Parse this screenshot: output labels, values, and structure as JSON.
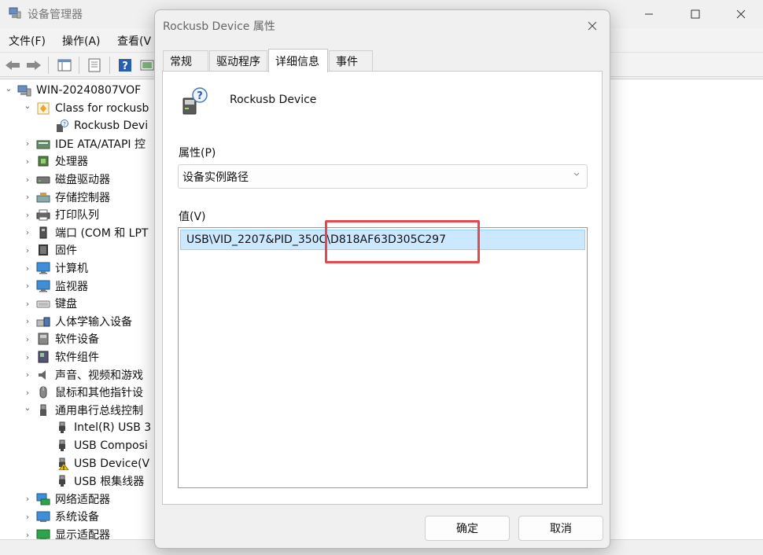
{
  "main_window": {
    "title": "设备管理器",
    "menu": [
      "文件(F)",
      "操作(A)",
      "查看(V"
    ],
    "tree": [
      {
        "label": "WIN-20240807VOF",
        "level": 0,
        "expand": "v",
        "icon": "computer-icon"
      },
      {
        "label": "Class for rockusb",
        "level": 1,
        "expand": "v",
        "icon": "class-icon"
      },
      {
        "label": "Rockusb Devi",
        "level": 2,
        "expand": "",
        "icon": "unknown-device-icon"
      },
      {
        "label": "IDE ATA/ATAPI 控",
        "level": 1,
        "expand": ">",
        "icon": "ide-icon"
      },
      {
        "label": "处理器",
        "level": 1,
        "expand": ">",
        "icon": "cpu-icon"
      },
      {
        "label": "磁盘驱动器",
        "level": 1,
        "expand": ">",
        "icon": "disk-icon"
      },
      {
        "label": "存储控制器",
        "level": 1,
        "expand": ">",
        "icon": "storage-icon"
      },
      {
        "label": "打印队列",
        "level": 1,
        "expand": ">",
        "icon": "printer-icon"
      },
      {
        "label": "端口 (COM 和 LPT",
        "level": 1,
        "expand": ">",
        "icon": "port-icon"
      },
      {
        "label": "固件",
        "level": 1,
        "expand": ">",
        "icon": "firmware-icon"
      },
      {
        "label": "计算机",
        "level": 1,
        "expand": ">",
        "icon": "monitor-icon"
      },
      {
        "label": "监视器",
        "level": 1,
        "expand": ">",
        "icon": "monitor-icon"
      },
      {
        "label": "键盘",
        "level": 1,
        "expand": ">",
        "icon": "keyboard-icon"
      },
      {
        "label": "人体学输入设备",
        "level": 1,
        "expand": ">",
        "icon": "hid-icon"
      },
      {
        "label": "软件设备",
        "level": 1,
        "expand": ">",
        "icon": "software-device-icon"
      },
      {
        "label": "软件组件",
        "level": 1,
        "expand": ">",
        "icon": "software-component-icon"
      },
      {
        "label": "声音、视频和游戏",
        "level": 1,
        "expand": ">",
        "icon": "speaker-icon"
      },
      {
        "label": "鼠标和其他指针设",
        "level": 1,
        "expand": ">",
        "icon": "mouse-icon"
      },
      {
        "label": "通用串行总线控制",
        "level": 1,
        "expand": "v",
        "icon": "usb-icon"
      },
      {
        "label": "Intel(R) USB 3",
        "level": 2,
        "expand": "",
        "icon": "usb-plug-icon"
      },
      {
        "label": "USB Composi",
        "level": 2,
        "expand": "",
        "icon": "usb-plug-icon"
      },
      {
        "label": "USB Device(V",
        "level": 2,
        "expand": "",
        "icon": "warning-usb-icon"
      },
      {
        "label": "USB 根集线器",
        "level": 2,
        "expand": "",
        "icon": "usb-plug-icon"
      },
      {
        "label": "网络适配器",
        "level": 1,
        "expand": ">",
        "icon": "network-icon"
      },
      {
        "label": "系统设备",
        "level": 1,
        "expand": ">",
        "icon": "system-icon"
      },
      {
        "label": "显示适配器",
        "level": 1,
        "expand": ">",
        "icon": "display-icon"
      }
    ]
  },
  "dialog": {
    "title": "Rockusb Device 属性",
    "tabs": [
      "常规",
      "驱动程序",
      "详细信息",
      "事件"
    ],
    "active_tab": "详细信息",
    "device_name": "Rockusb Device",
    "property_label": "属性(P)",
    "property_value": "设备实例路径",
    "value_label": "值(V)",
    "value_item": "USB\\VID_2207&PID_350C\\D818AF63D305C297",
    "ok_label": "确定",
    "cancel_label": "取消"
  },
  "colors": {
    "selection_bg": "#cce8ff",
    "highlight_box": "#e5484d"
  }
}
